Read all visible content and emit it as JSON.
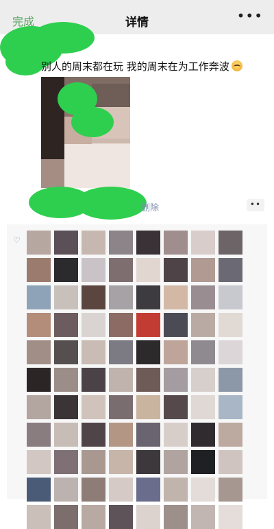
{
  "nav": {
    "back_label": "完成",
    "title": "详情",
    "more": "•••"
  },
  "post": {
    "text": "别人的周末都在玩 我的周末在为工作奔波",
    "emoji_icon": "tired-face-emoji",
    "delete_label": "删除",
    "comment_button": "••"
  },
  "likes": {
    "icon": "heart-icon",
    "avatar_colors": [
      "#b7a7a1",
      "#5b4f58",
      "#c6b7b0",
      "#8d8489",
      "#3a3236",
      "#a08d8d",
      "#d8cdca",
      "#6d6468",
      "#9a7b6d",
      "#2b2a2d",
      "#c9c3c7",
      "#7f6e70",
      "#e2d6d1",
      "#4e4448",
      "#b09a92",
      "#6b6a74",
      "#8fa3b8",
      "#c7c0bb",
      "#5a463f",
      "#a7a2a6",
      "#3d3a40",
      "#d3b8a6",
      "#9a8d92",
      "#c8c9cf",
      "#b48c7a",
      "#6c5c5f",
      "#d9d4d1",
      "#8b6b63",
      "#c23c34",
      "#4a4b55",
      "#b9aaa3",
      "#e1d9d4",
      "#a18e86",
      "#55504f",
      "#c9bcb5",
      "#7c7a83",
      "#2d2a2c",
      "#bfa49a",
      "#8f8a90",
      "#dcd6d8",
      "#2c2526",
      "#9b8e88",
      "#4b4247",
      "#c0b2ac",
      "#6e5b58",
      "#a49ca0",
      "#d7cfcb",
      "#8c98a8",
      "#b3a59f",
      "#3a3437",
      "#d0c3bc",
      "#7a6d70",
      "#c8b49f",
      "#55494c",
      "#e0d8d4",
      "#a8b6c6",
      "#8a7d80",
      "#c7bcb6",
      "#4f4549",
      "#b49685",
      "#6a6470",
      "#d8cec9",
      "#2f2b2e",
      "#bca9a0",
      "#d2c7c2",
      "#7e7075",
      "#a89890",
      "#c6b5a8",
      "#3d383b",
      "#b1a4a0",
      "#1f2024",
      "#cfc4c0",
      "#4a5b78",
      "#bcb3b0",
      "#8e7d77",
      "#d5cac6",
      "#6a6e8c",
      "#c1b4ad",
      "#e3dcd8",
      "#a69890",
      "#cbbfb9",
      "#7b6e6c",
      "#b8a9a2",
      "#5d5358",
      "#dcd3cf",
      "#9d8f8a",
      "#c2b6b2",
      "#e4ddda"
    ]
  }
}
